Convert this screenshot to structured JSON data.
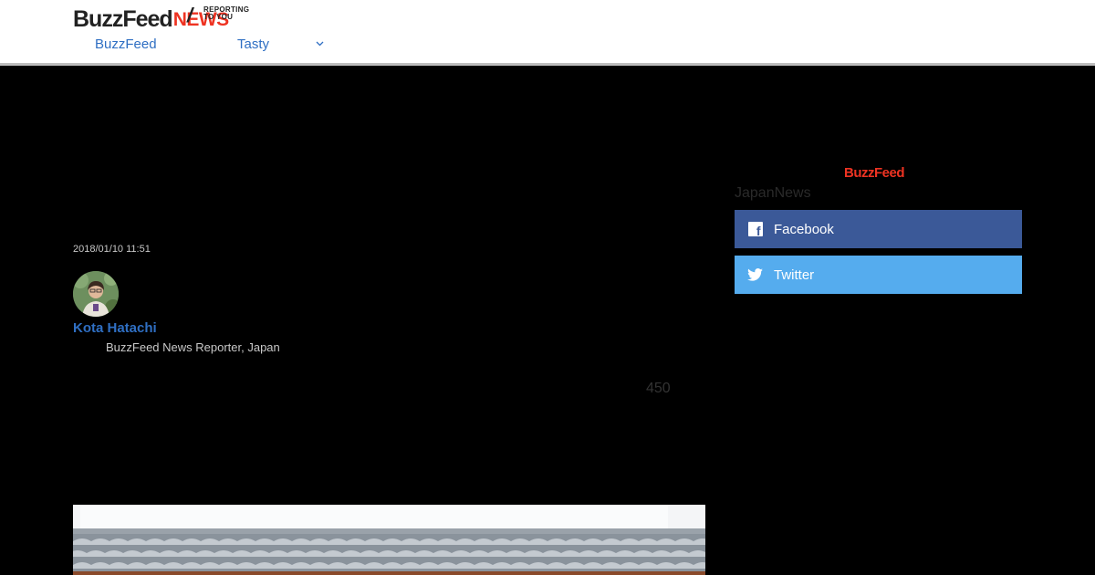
{
  "header": {
    "logo_primary": "BuzzFeed",
    "logo_secondary": "NEWS",
    "tagline_line1": "REPORTING",
    "tagline_line2": "TO YOU",
    "nav": [
      {
        "label": "BuzzFeed"
      },
      {
        "label": "Tasty"
      }
    ]
  },
  "article": {
    "date": "2018/01/10 11:51",
    "author": {
      "name": "Kota Hatachi",
      "title": "BuzzFeed News Reporter, Japan"
    },
    "count": "450"
  },
  "sidebar": {
    "brand": "BuzzFeed",
    "brand_sub": "JapanNews",
    "share": [
      {
        "label": "Facebook",
        "icon": "facebook-icon",
        "color": "#3b5998"
      },
      {
        "label": "Twitter",
        "icon": "twitter-icon",
        "color": "#55acee"
      }
    ]
  },
  "colors": {
    "brand_red": "#ee3322",
    "link_blue": "#2f6fc3"
  }
}
